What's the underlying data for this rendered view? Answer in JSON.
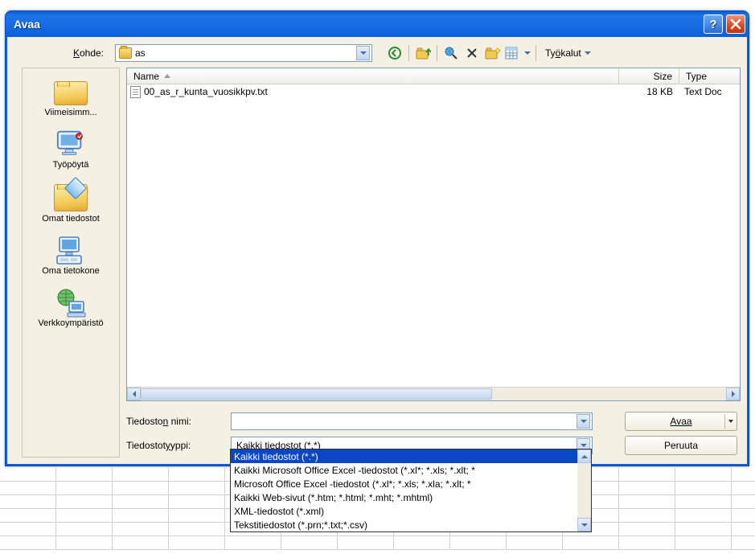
{
  "window": {
    "title": "Avaa"
  },
  "labels": {
    "lookin": "Kohde:",
    "filename_html": "Tiedosto<u>n</u> nimi:",
    "filetype_html": "Tiedostot<u>y</u>yppi:",
    "tools_html": "Ty<u>ö</u>kalut"
  },
  "lookin": {
    "folder": "as"
  },
  "places": {
    "recent": "Viimeisimm...",
    "desktop": "Työpöytä",
    "mydocs": "Omat tiedostot",
    "mycomputer": "Oma tietokone",
    "network": "Verkkoympäristö"
  },
  "columns": {
    "name": "Name",
    "size": "Size",
    "type": "Type"
  },
  "files": [
    {
      "name": "00_as_r_kunta_vuosikkpv.txt",
      "size": "18 KB",
      "type": "Text Doc"
    }
  ],
  "filename_value": "",
  "filetype_value": "Kaikki tiedostot (*.*)",
  "filetype_options": [
    "Kaikki tiedostot (*.*)",
    "Kaikki Microsoft Office Excel -tiedostot (*.xl*; *.xls; *.xlt; *",
    "Microsoft Office Excel -tiedostot (*.xl*; *.xls; *.xla; *.xlt; *",
    "Kaikki Web-sivut (*.htm; *.html; *.mht; *.mhtml)",
    "XML-tiedostot (*.xml)",
    "Tekstitiedostot (*.prn;*.txt;*.csv)"
  ],
  "buttons": {
    "open": "Avaa",
    "cancel": "Peruuta"
  }
}
